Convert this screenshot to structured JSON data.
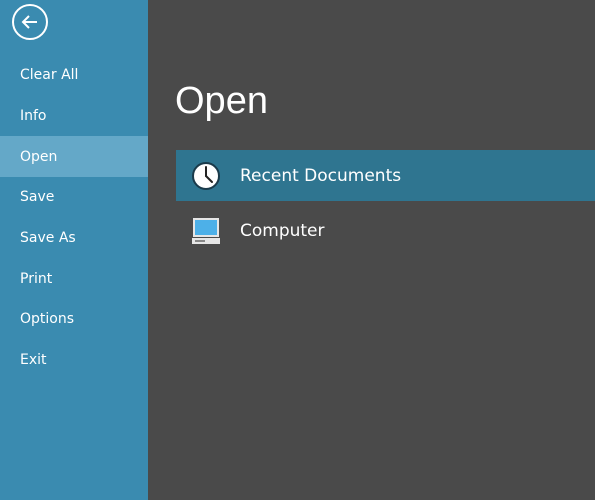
{
  "sidebar": {
    "back_icon": "arrow-left-circle-icon",
    "items": [
      {
        "label": "Clear All"
      },
      {
        "label": "Info"
      },
      {
        "label": "Open"
      },
      {
        "label": "Save"
      },
      {
        "label": "Save As"
      },
      {
        "label": "Print"
      },
      {
        "label": "Options"
      },
      {
        "label": "Exit"
      }
    ],
    "active": "Open"
  },
  "main": {
    "title": "Open",
    "options": [
      {
        "label": "Recent Documents",
        "icon": "clock-icon",
        "selected": true
      },
      {
        "label": "Computer",
        "icon": "computer-icon",
        "selected": false
      }
    ]
  },
  "colors": {
    "sidebar": "#3a8bb0",
    "sidebar_active": "#64a8c8",
    "background": "#4a4a4a",
    "selected_option": "#2f7590"
  }
}
